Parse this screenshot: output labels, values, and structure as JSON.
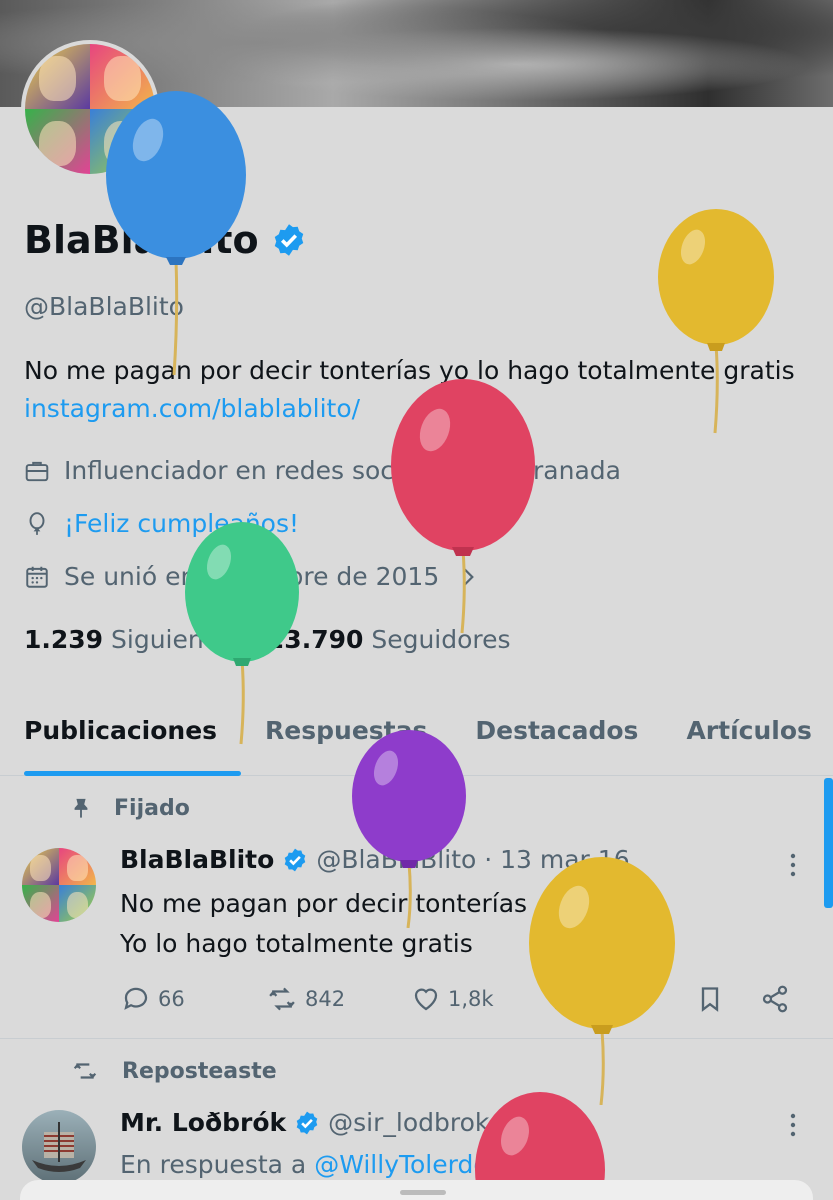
{
  "profile": {
    "display_name": "BlaBlaBlito",
    "handle": "@BlaBlaBlito",
    "bio_text": "No me pagan por decir tonterías yo lo hago totalmente gratis",
    "bio_link": "instagram.com/blablablito/",
    "category": "Influenciador en redes sociales",
    "location": "Granada",
    "birthday": "¡Feliz cumpleaños!",
    "joined": "Se unió en diciembre de 2015",
    "following_count": "1.239",
    "following_label": "Siguiendo",
    "followers_count": "23.790",
    "followers_label": "Seguidores"
  },
  "tabs": [
    {
      "label": "Publicaciones",
      "active": true
    },
    {
      "label": "Respuestas",
      "active": false
    },
    {
      "label": "Destacados",
      "active": false
    },
    {
      "label": "Artículos",
      "active": false
    }
  ],
  "pinned_tweet": {
    "pinned_label": "Fijado",
    "name": "BlaBlaBlito",
    "handle_time": "@BlaBlaBlito · 13 mar 16",
    "line1": "No me pagan por decir tonterías",
    "line2": "Yo lo hago totalmente gratis",
    "replies": "66",
    "reposts": "842",
    "likes": "1,8k"
  },
  "repost_tweet": {
    "repost_label": "Reposteaste",
    "name": "Mr. Loðbrók",
    "handle_time": "@sir_lodbrok · 18h",
    "reply_prefix": "En respuesta a",
    "reply_to": "@WillyTolerdoo"
  },
  "colors": {
    "accent": "#1d9bf0",
    "background": "#dadada",
    "balloon_blue": "#3b8fe0",
    "balloon_yellow": "#e3b92f",
    "balloon_red": "#e04362",
    "balloon_green": "#3fc98a",
    "balloon_purple": "#8e3ccb"
  },
  "icons": [
    "verified-badge-icon",
    "briefcase-icon",
    "location-pin-icon",
    "balloon-icon",
    "calendar-icon",
    "chevron-right-icon",
    "pin-icon",
    "reply-icon",
    "repost-icon",
    "like-icon",
    "views-icon",
    "bookmark-icon",
    "share-icon",
    "more-icon"
  ]
}
